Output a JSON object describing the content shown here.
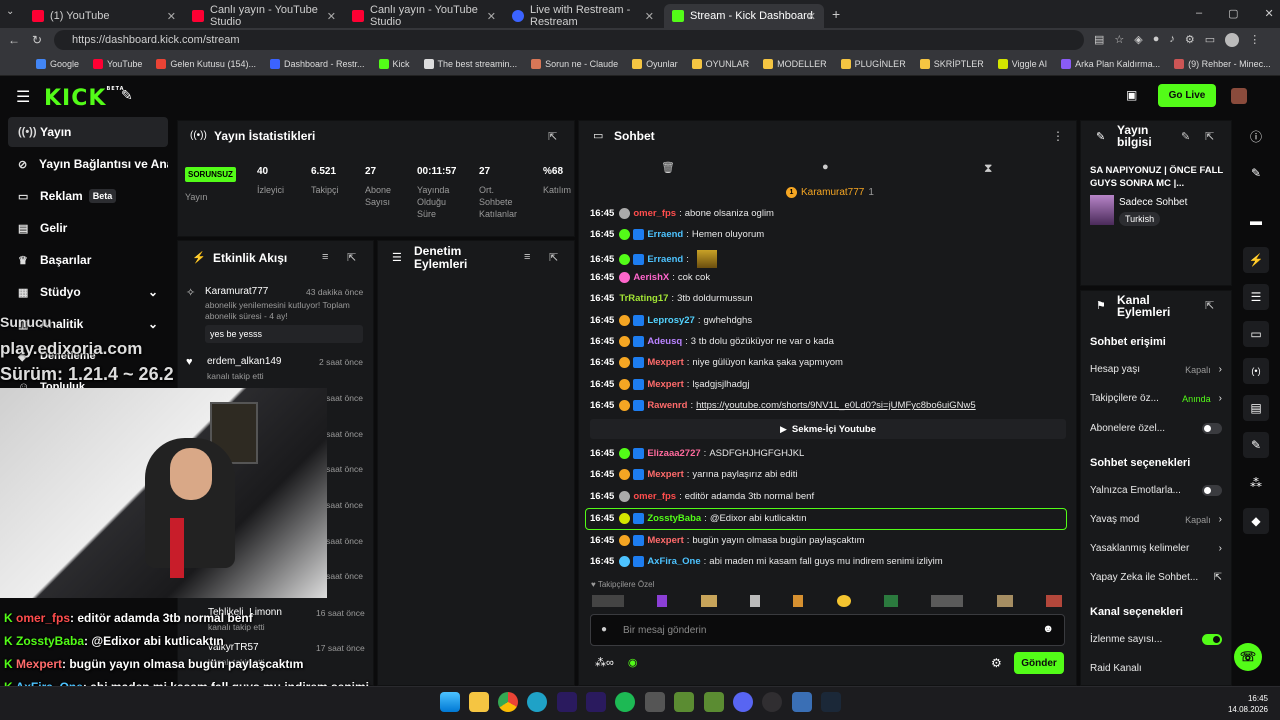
{
  "browser": {
    "tabs": [
      {
        "title": "(1) YouTube",
        "color": "#ff0033"
      },
      {
        "title": "Canlı yayın - YouTube Studio",
        "color": "#ff0033"
      },
      {
        "title": "Canlı yayın - YouTube Studio",
        "color": "#ff0033"
      },
      {
        "title": "Live with Restream - Restream",
        "color": "#3b63ff"
      },
      {
        "title": "Stream - Kick Dashboard",
        "color": "#53fc18"
      }
    ],
    "url": "https://dashboard.kick.com/stream",
    "bookmarks": [
      "Google",
      "YouTube",
      "Gelen Kutusu (154)...",
      "Dashboard - Restr...",
      "Kick",
      "The best streamin...",
      "Sorun ne - Claude",
      "Oyunlar",
      "OYUNLAR",
      "MODELLER",
      "PLUGİNLER",
      "SKRİPTLER",
      "Viggle AI",
      "Arka Plan Kaldırma...",
      "(9) Rehber - Minec..."
    ]
  },
  "header": {
    "logo": "KICK",
    "logo_sup": "BETA",
    "go_live": "Go Live"
  },
  "sidebar": {
    "items": [
      {
        "label": "Yayın",
        "icon": "broadcast-icon"
      },
      {
        "label": "Yayın Bağlantısı ve Anahtar",
        "icon": "link-icon"
      },
      {
        "label": "Reklam",
        "icon": "ad-icon",
        "badge": "Beta"
      },
      {
        "label": "Gelir",
        "icon": "money-icon"
      },
      {
        "label": "Başarılar",
        "icon": "trophy-icon"
      },
      {
        "label": "Stüdyo",
        "icon": "studio-icon"
      },
      {
        "label": "Analitik",
        "icon": "chart-icon"
      },
      {
        "label": "Denetleme",
        "icon": "shield-icon"
      },
      {
        "label": "Topluluk",
        "icon": "users-icon"
      }
    ]
  },
  "stats": {
    "title": "Yayın İstatistikleri",
    "status": "SORUNSUZ",
    "status_label": "Yayın",
    "items": [
      {
        "value": "40",
        "label": "İzleyici"
      },
      {
        "value": "6.521",
        "label": "Takipçi"
      },
      {
        "value": "27",
        "label": "Abone Sayısı"
      },
      {
        "value": "00:11:57",
        "label": "Yayında Olduğu Süre"
      },
      {
        "value": "27",
        "label": "Ort. Sohbete Katılanlar"
      },
      {
        "value": "%68",
        "label": "Katılım"
      }
    ]
  },
  "activity": {
    "title": "Etkinlik Akışı",
    "items": [
      {
        "user": "Karamurat777",
        "time": "43 dakika önce",
        "text": "abonelik yenilemesini kutluyor! Toplam abonelik süresi - 4 ay!",
        "quote": "yes be yesss"
      },
      {
        "user": "erdem_alkan149",
        "time": "2 saat önce",
        "text": "kanalı takip etti"
      },
      {
        "time": "2 saat önce"
      },
      {
        "time": "2 saat önce"
      },
      {
        "time": "2 saat önce"
      },
      {
        "time": "2 saat önce"
      },
      {
        "time": "2 saat önce"
      },
      {
        "time": "2 saat önce"
      },
      {
        "user": "Tehlikeli_Limonn",
        "time": "16 saat önce",
        "text": "kanalı takip etti"
      },
      {
        "user": "valkyrTR57",
        "time": "17 saat önce",
        "text": "kanalı takip etti"
      }
    ]
  },
  "moderation": {
    "title": "Denetim Eylemleri"
  },
  "chat": {
    "title": "Sohbet",
    "pinned_user": "Karamurat777",
    "pinned_count": "1",
    "messages": [
      {
        "time": "16:45",
        "user": "omer_fps",
        "color": "#ff4d4d",
        "text": "abone olsaniza oglim"
      },
      {
        "time": "16:45",
        "user": "Erraend",
        "color": "#4dc3ff",
        "text": "Hemen oluyorum"
      },
      {
        "time": "16:45",
        "user": "Erraend",
        "color": "#4dc3ff",
        "text": ""
      },
      {
        "time": "16:45",
        "user": "AerishX",
        "color": "#ff66cc",
        "text": "cok cok"
      },
      {
        "time": "16:45",
        "user": "TrRating17",
        "color": "#a3e635",
        "text": "3tb doldurmussun"
      },
      {
        "time": "16:45",
        "user": "Leprosy27",
        "color": "#53d3ff",
        "text": "gwhehdghs"
      },
      {
        "time": "16:45",
        "user": "Adeusq",
        "color": "#b983ff",
        "text": "3 tb dolu gözüküyor ne var o kada"
      },
      {
        "time": "16:45",
        "user": "Mexpert",
        "color": "#ff6b6b",
        "text": "niye gülüyon kanka şaka yapmıyom"
      },
      {
        "time": "16:45",
        "user": "Mexpert",
        "color": "#ff6b6b",
        "text": "lşadgjsjlhadgj"
      },
      {
        "time": "16:45",
        "user": "Rawenrd",
        "color": "#ff6b6b",
        "text": "https://youtube.com/shorts/9NV1L_e0Ld0?si=jUMFyc8bo6uiGNw5"
      },
      {
        "time": "16:45",
        "user": "Elizaaa2727",
        "color": "#ff6b9d",
        "text": "ASDFGHJHGFGHJKL"
      },
      {
        "time": "16:45",
        "user": "Mexpert",
        "color": "#ff6b6b",
        "text": "yarına paylaşırız abi editi"
      },
      {
        "time": "16:45",
        "user": "omer_fps",
        "color": "#ff4d4d",
        "text": "editör adamda 3tb normal benf"
      },
      {
        "time": "16:45",
        "user": "ZosstyBaba",
        "color": "#53fc18",
        "text": "@Edixor abi kutlicaktın"
      },
      {
        "time": "16:45",
        "user": "Mexpert",
        "color": "#ff6b6b",
        "text": "bugün yayın olmasa bugün paylaşcaktım"
      },
      {
        "time": "16:45",
        "user": "AxFira_One",
        "color": "#4dc3ff",
        "text": "abi maden mi kasam fall guys mu indirem senimi izliyim"
      }
    ],
    "youtube_divider": "Sekme-İçi Youtube",
    "followers_only": "Takipçilere Özel",
    "input_placeholder": "Bir mesaj gönderin",
    "send": "Gönder"
  },
  "stream_info": {
    "title": "Yayın bilgisi",
    "stream_title": "SA NAPIYONUZ | ÖNCE FALL GUYS SONRA MC |...",
    "category": "Sadece Sohbet",
    "tag": "Turkish"
  },
  "channel_actions": {
    "title": "Kanal Eylemleri",
    "chat_access": "Sohbet erişimi",
    "rows1": [
      {
        "label": "Hesap yaşı",
        "value": "Kapalı"
      },
      {
        "label": "Takipçilere öz...",
        "value": "Anında"
      },
      {
        "label": "Abonelere özel...",
        "toggle": false
      }
    ],
    "chat_options": "Sohbet seçenekleri",
    "rows2": [
      {
        "label": "Yalnızca Emotlarla...",
        "toggle": false
      },
      {
        "label": "Yavaş mod",
        "value": "Kapalı"
      },
      {
        "label": "Yasaklanmış kelimeler",
        "value": ""
      },
      {
        "label": "Yapay Zeka ile Sohbet...",
        "value": ""
      }
    ],
    "channel_options": "Kanal seçenekleri",
    "rows3": [
      {
        "label": "İzlenme sayısı...",
        "toggle": true
      },
      {
        "label": "Raid Kanalı",
        "value": ""
      }
    ]
  },
  "overlay": {
    "server_l1": "Sunucu",
    "server_l2": "play.edixoria.com",
    "server_l3": "Sürüm: 1.21.4 ~ 26.2",
    "lines": [
      {
        "user": "omer_fps",
        "color": "#ff4d4d",
        "text": ": editör adamda 3tb normal benf"
      },
      {
        "user": "ZosstyBaba",
        "color": "#53fc18",
        "text": ": @Edixor abi kutlicaktın"
      },
      {
        "user": "Mexpert",
        "color": "#ff6b6b",
        "text": ": bugün yayın olmasa bugün paylaşcaktım"
      },
      {
        "user": "AxFira_One",
        "color": "#4dc3ff",
        "text": ": abi maden mi kasam fall guys mu indirem senimi"
      }
    ],
    "last_line": "izliyim"
  },
  "taskbar": {
    "time": "16:45",
    "date": "14.08.2026"
  }
}
